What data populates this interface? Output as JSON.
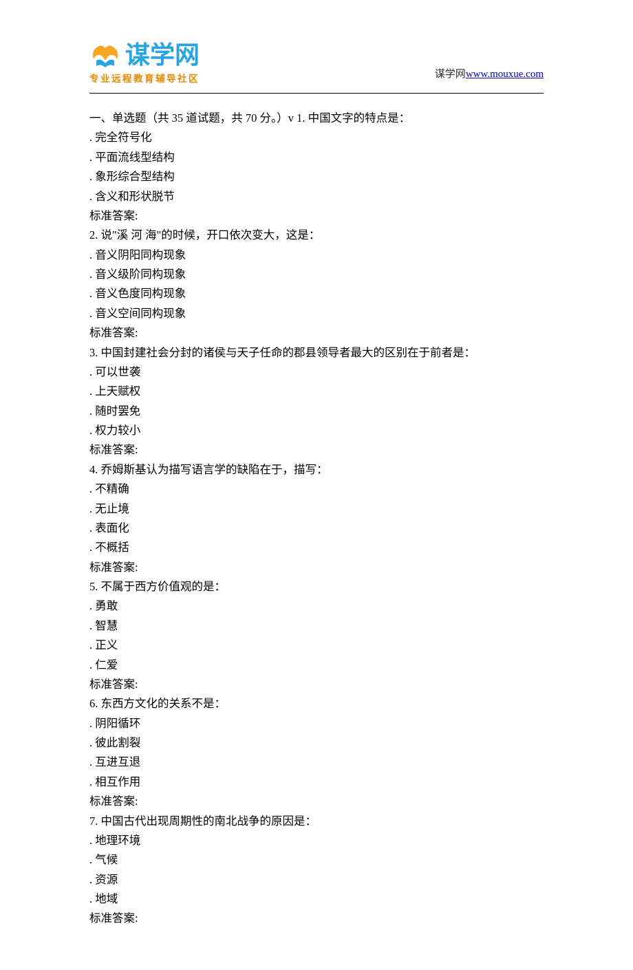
{
  "header": {
    "logo_text": "谋学网",
    "logo_sub": "专业远程教育辅导社区",
    "right_text": "谋学网",
    "right_link": "www.mouxue.com"
  },
  "section_header": "一、单选题（共 35 道试题，共 70 分。）v 1.   中国文字的特点是：",
  "answer_label": "标准答案:",
  "questions": [
    {
      "num": "1",
      "text": "",
      "options": [
        "完全符号化",
        "平面流线型结构",
        "象形综合型结构",
        "含义和形状脱节"
      ]
    },
    {
      "num": "2",
      "text": "说\"溪 河 海\"的时候，开口依次变大，这是：",
      "options": [
        "音义阴阳同构现象",
        "音义级阶同构现象",
        "音义色度同构现象",
        "音义空间同构现象"
      ]
    },
    {
      "num": "3",
      "text": "中国封建社会分封的诸侯与天子任命的郡县领导者最大的区别在于前者是：",
      "options": [
        "可以世袭",
        "上天赋权",
        "随时罢免",
        "权力较小"
      ]
    },
    {
      "num": "4",
      "text": "乔姆斯基认为描写语言学的缺陷在于，描写：",
      "options": [
        "不精确",
        "无止境",
        "表面化",
        "不概括"
      ]
    },
    {
      "num": "5",
      "text": "不属于西方价值观的是：",
      "options": [
        "勇敢",
        "智慧",
        "正义",
        "仁爱"
      ]
    },
    {
      "num": "6",
      "text": "东西方文化的关系不是：",
      "options": [
        "阴阳循环",
        "彼此割裂",
        "互进互退",
        "相互作用"
      ]
    },
    {
      "num": "7",
      "text": "中国古代出现周期性的南北战争的原因是：",
      "options": [
        "地理环境",
        "气候",
        "资源",
        "地域"
      ]
    }
  ]
}
